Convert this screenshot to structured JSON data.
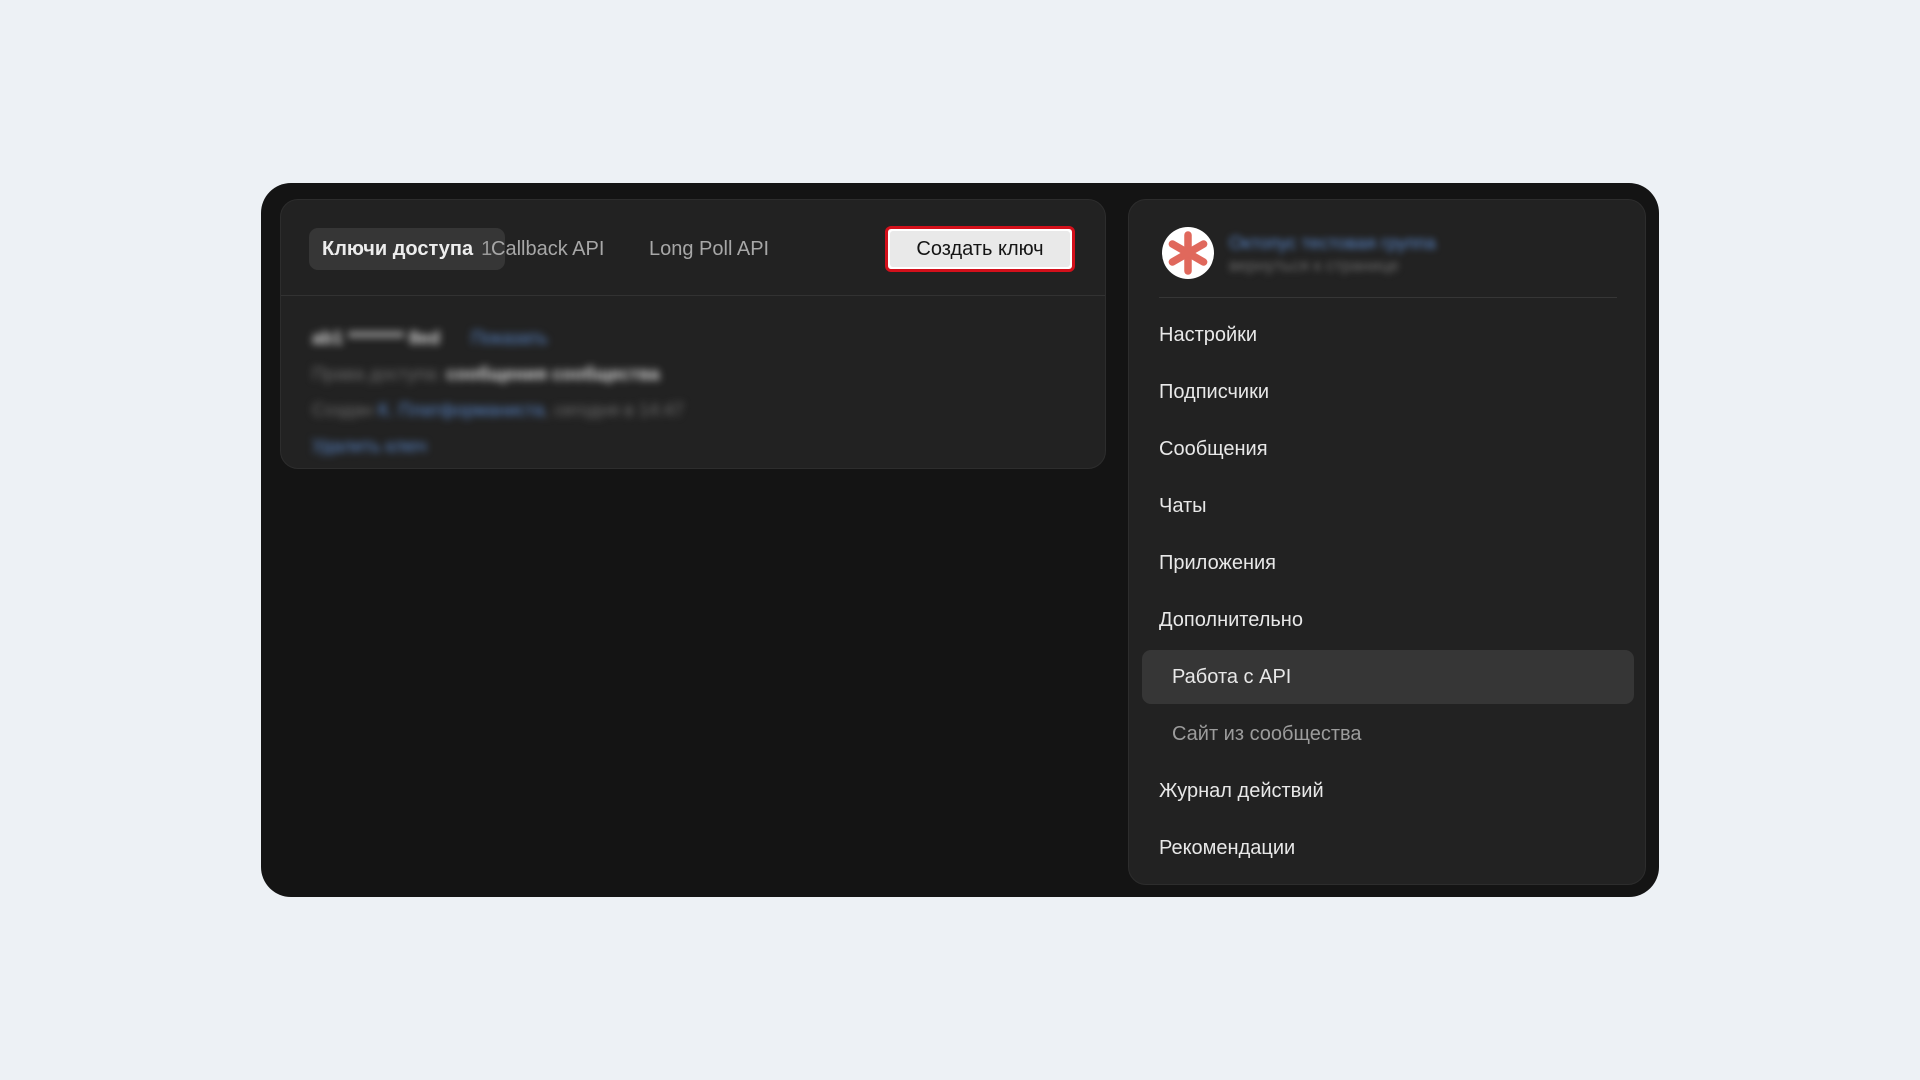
{
  "tabs": [
    {
      "label": "Ключи доступа",
      "count": "1"
    },
    {
      "label": "Callback API"
    },
    {
      "label": "Long Poll API"
    }
  ],
  "create_key_label": "Создать ключ",
  "key": {
    "id": "ab1 ******** 8ed",
    "show_label": "Показать",
    "rights_label": "Права доступа:",
    "rights_value": "сообщения сообщества",
    "created_label": "Создан",
    "created_by": "К. Платформаниста",
    "created_time": "сегодня в 14:47",
    "delete_label": "Удалить ключ"
  },
  "group": {
    "name": "Октопус тестовая группа",
    "back_label": "вернуться к странице",
    "avatar_icon": "asterisk-icon",
    "avatar_color": "#e0685c"
  },
  "nav": [
    {
      "label": "Настройки"
    },
    {
      "label": "Подписчики"
    },
    {
      "label": "Сообщения"
    },
    {
      "label": "Чаты"
    },
    {
      "label": "Приложения"
    },
    {
      "label": "Дополнительно"
    },
    {
      "label": "Работа с API"
    },
    {
      "label": "Сайт из сообщества"
    },
    {
      "label": "Журнал действий"
    },
    {
      "label": "Рекомендации"
    }
  ],
  "colors": {
    "highlight_border": "#d3101b",
    "link": "#5a87c9"
  }
}
